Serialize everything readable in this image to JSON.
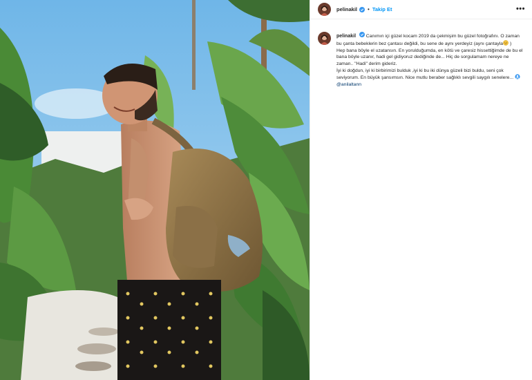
{
  "post": {
    "username": "pelinakil",
    "follow_label": "Takip Et",
    "separator": "•",
    "more_label": "•••"
  },
  "caption": {
    "username": "pelinakil",
    "line1": "Canımın içi güzel kocam 2019 da çekmişim bu güzel fotoğrafını. O zaman bu çanta bebeklerin bez çantası değildi, bu sene de aynı yerdeyiz (aynı çantayla",
    "line1_end": ")",
    "paragraph2": "Hep bana böyle el uzatansın. En yorulduğumda, en kötü ve çaresiz hissettiğimde de bu el bana böyle uzanır, hadi gel gidiyoruz dediğinde de... Hiç de sorgulamam nereye ne zaman.. \"Hadi\" derim gideriz.",
    "paragraph3": "İyi ki doğdun, iyi ki birbirimizi bulduk ,iyi ki bu iki dünya güzeli bizi buldu, seni çok seviyorum. En büyük şansımsın. Nice mutlu beraber sağlıklı sevgili saygılı senelere...",
    "mention": "@anilaltann"
  },
  "colors": {
    "link_blue": "#0095f6",
    "verified_blue": "#3897f0",
    "mention_blue": "#00376b"
  },
  "icons": {
    "verified": "verified-badge-icon",
    "more": "more-options-icon",
    "mention": "tag-icon",
    "emoji": "smile-emoji-icon"
  }
}
